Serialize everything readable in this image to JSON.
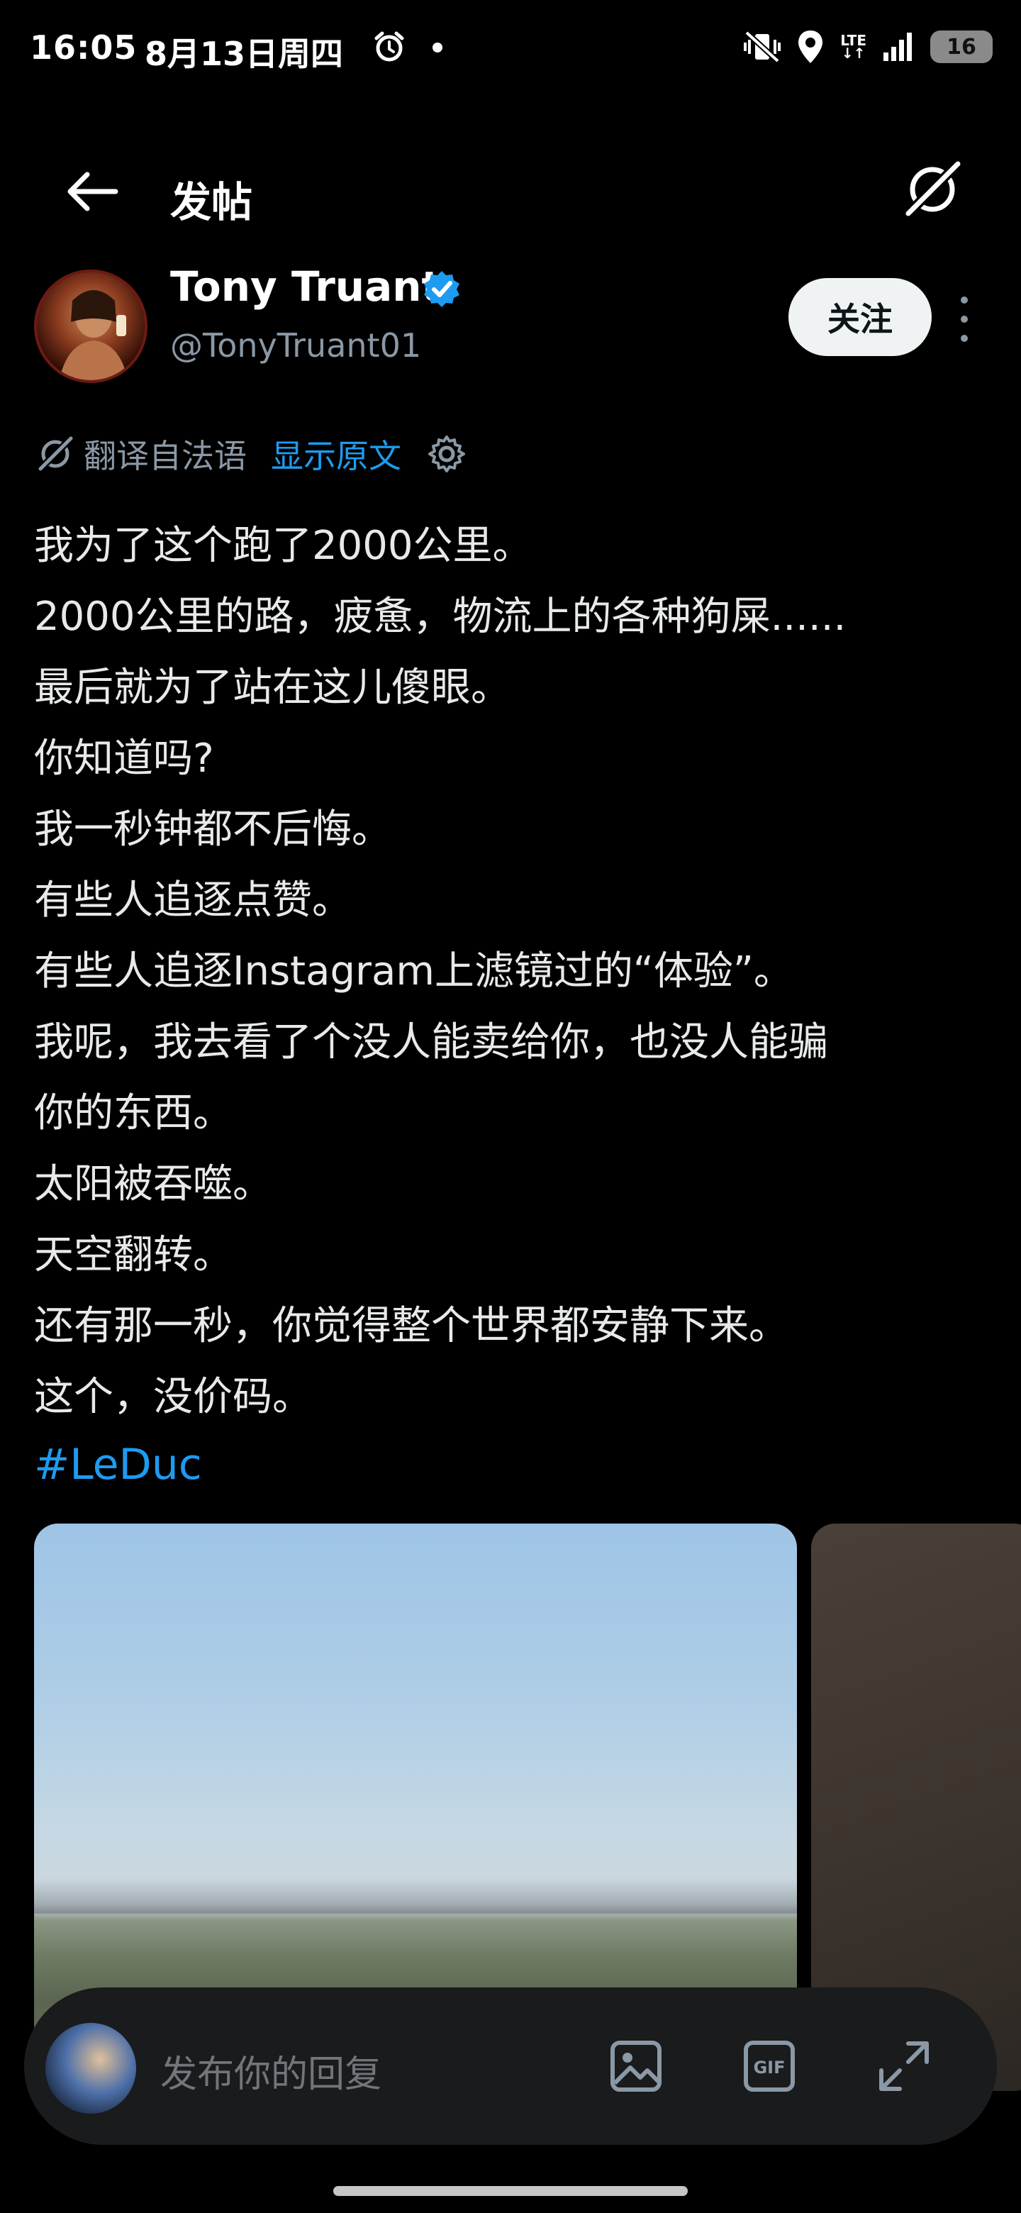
{
  "status_bar": {
    "time": "16:05",
    "date": "8月13日周四",
    "network": "LTE",
    "battery": "16",
    "icons": [
      "alarm-icon",
      "vibrate-icon",
      "location-icon",
      "lte-icon",
      "signal-icon",
      "battery-icon"
    ]
  },
  "header": {
    "title": "发帖",
    "back_icon": "arrow-left-icon",
    "grok_icon": "grok-icon"
  },
  "author": {
    "name": "Tony Truant",
    "handle": "@TonyTruant01",
    "verified": true,
    "follow_label": "关注"
  },
  "translation": {
    "label": "翻译自法语",
    "show_original": "显示原文"
  },
  "tweet": {
    "lines": [
      "我为了这个跑了2000公里。",
      "2000公里的路，疲惫，物流上的各种狗屎......",
      "最后就为了站在这儿傻眼。",
      "你知道吗?",
      "我一秒钟都不后悔。",
      "有些人追逐点赞。",
      "有些人追逐Instagram上滤镜过的“体验”。",
      "我呢，我去看了个没人能卖给你，也没人能骗",
      "你的东西。",
      "太阳被吞噬。",
      "天空翻转。",
      "还有那一秒，你觉得整个世界都安静下来。",
      "这个，没价码。"
    ],
    "hashtag": "#LeDuc"
  },
  "reply": {
    "placeholder": "发布你的回复",
    "gif_label": "GIF"
  },
  "colors": {
    "background": "#000000",
    "accent": "#1d9bf0",
    "text": "#e7e9ea",
    "secondary_text": "#8b98a5"
  }
}
